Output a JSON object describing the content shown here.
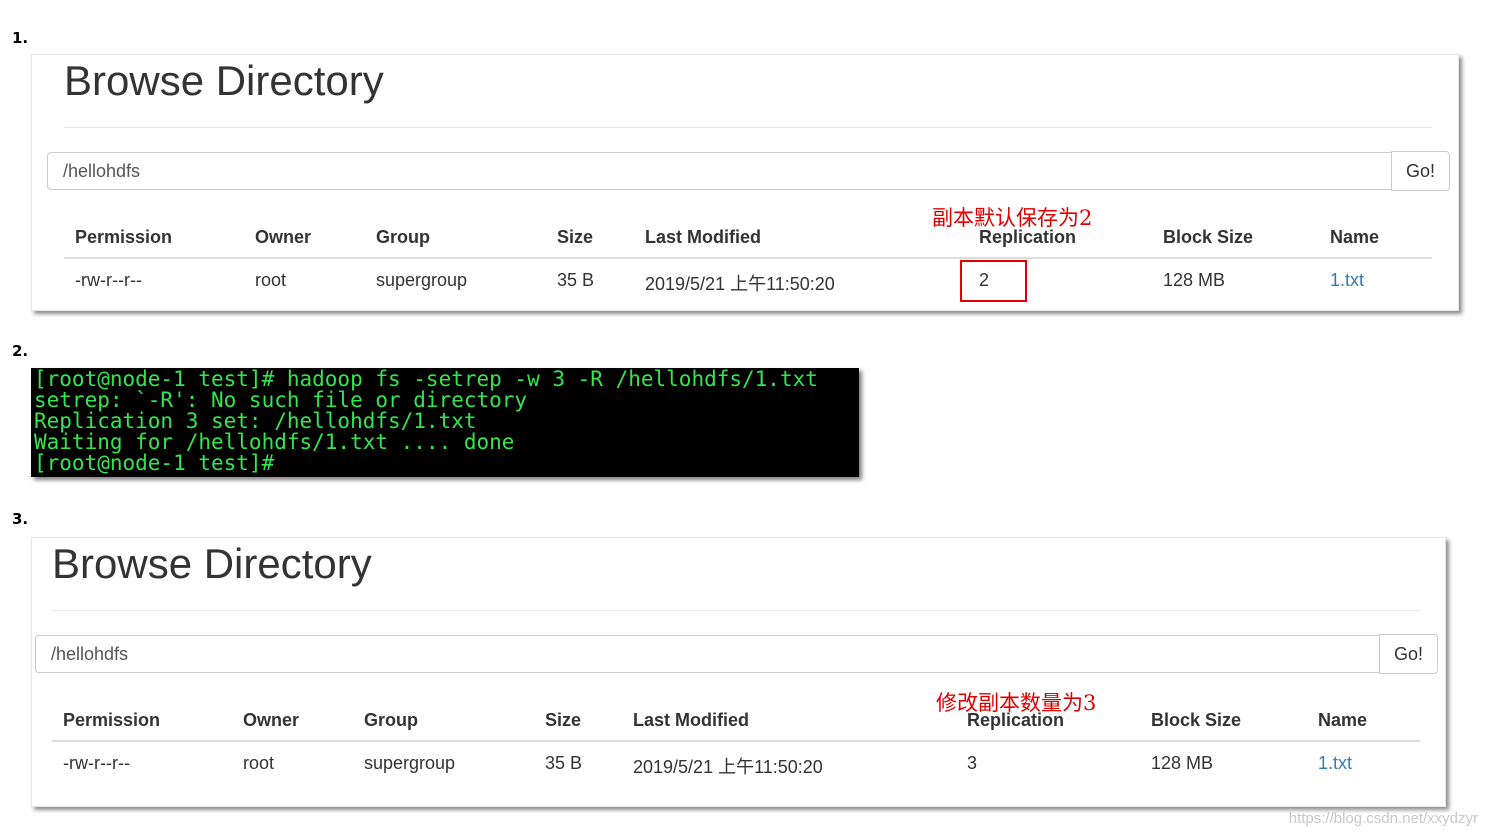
{
  "steps": [
    "1.",
    "2.",
    "3."
  ],
  "panel1": {
    "title": "Browse Directory",
    "path_value": "/hellohdfs",
    "go_label": "Go!",
    "headers": [
      "Permission",
      "Owner",
      "Group",
      "Size",
      "Last Modified",
      "Replication",
      "Block Size",
      "Name"
    ],
    "row": [
      "-rw-r--r--",
      "root",
      "supergroup",
      "35 B",
      "2019/5/21 上午11:50:20",
      "2",
      "128 MB",
      "1.txt"
    ],
    "annotation": "副本默认保存为2"
  },
  "terminal": {
    "lines": [
      "[root@node-1 test]# hadoop fs -setrep -w 3 -R /hellohdfs/1.txt",
      "setrep: `-R': No such file or directory",
      "Replication 3 set: /hellohdfs/1.txt",
      "Waiting for /hellohdfs/1.txt .... done",
      "[root@node-1 test]#"
    ]
  },
  "panel2": {
    "title": "Browse Directory",
    "path_value": "/hellohdfs",
    "go_label": "Go!",
    "headers": [
      "Permission",
      "Owner",
      "Group",
      "Size",
      "Last Modified",
      "Replication",
      "Block Size",
      "Name"
    ],
    "row": [
      "-rw-r--r--",
      "root",
      "supergroup",
      "35 B",
      "2019/5/21 上午11:50:20",
      "3",
      "128 MB",
      "1.txt"
    ],
    "annotation": "修改副本数量为3"
  },
  "watermark": "https://blog.csdn.net/xxydzyr",
  "colors": {
    "terminal_bg": "#000000",
    "terminal_text": "#33e54f",
    "annotation": "#e00000",
    "link": "#337ab7"
  }
}
